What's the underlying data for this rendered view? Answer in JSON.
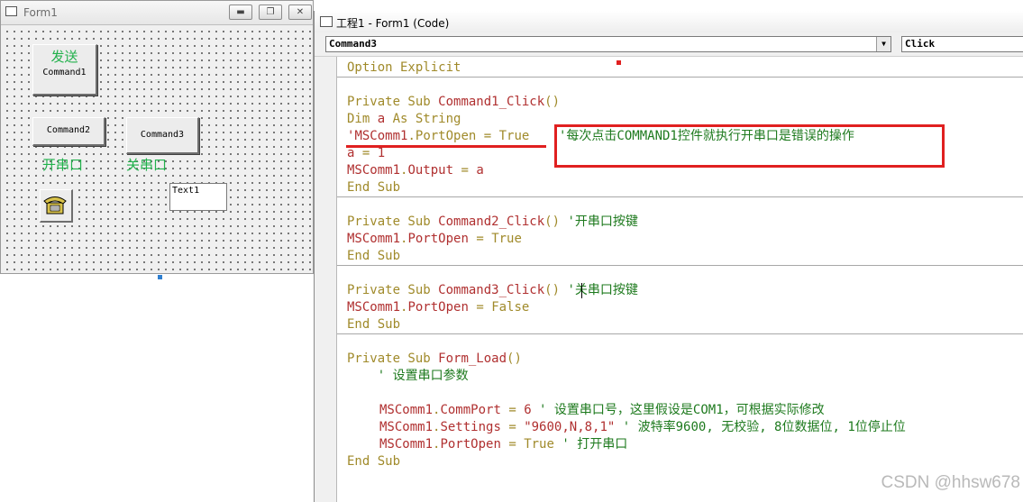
{
  "form_window": {
    "title": "Form1",
    "controls": {
      "send_caption": "发送",
      "command1": "Command1",
      "command2": "Command2",
      "command3": "Command3",
      "open_port_label": "开串口",
      "close_port_label": "关串口",
      "text1": "Text1"
    }
  },
  "code_window": {
    "title": "工程1 - Form1 (Code)",
    "object_combo": "Command3",
    "proc_combo": "Click",
    "lines": {
      "l1": "Option Explicit",
      "l2_kw": "Private Sub ",
      "l2_id": "Command1_Click",
      "l2_p": "()",
      "l3_kw": "Dim ",
      "l3_var": "a",
      "l3_rest": " As String",
      "l4_q": "'",
      "l4_obj": "MSComm1",
      "l4_dot": ".",
      "l4_prop": "PortOpen",
      "l4_eq": " = ",
      "l4_val": "True",
      "l4_comment": "'每次点击COMMAND1控件就执行开串口是错误的操作",
      "l5_var": "a",
      "l5_eq": " = ",
      "l5_num": "1",
      "l6_obj": "MSComm1",
      "l6_dot": ".",
      "l6_prop": "Output",
      "l6_eq": " = ",
      "l6_var": "a",
      "l7": "End Sub",
      "l8_kw": "Private Sub ",
      "l8_id": "Command2_Click",
      "l8_p": "()",
      "l8_comment": " '开串口按键",
      "l9_obj": "MSComm1",
      "l9_dot": ".",
      "l9_prop": "PortOpen",
      "l9_eq": " = ",
      "l9_val": "True",
      "l10": "End Sub",
      "l11_kw": "Private Sub ",
      "l11_id": "Command3_Click",
      "l11_p": "()",
      "l11_comment": " '关串口按键",
      "l12_obj": "MSComm1",
      "l12_dot": ".",
      "l12_prop": "PortOpen",
      "l12_eq": " = ",
      "l12_val": "False",
      "l13": "End Sub",
      "l14_kw": "Private Sub ",
      "l14_id": "Form_Load",
      "l14_p": "()",
      "l15": "    ' 设置串口参数",
      "l16_obj": "MSComm1",
      "l16_dot": ".",
      "l16_prop": "CommPort",
      "l16_eq": " = ",
      "l16_num": "6",
      "l16_comment": " ' 设置串口号，这里假设是COM1，可根据实际修改",
      "l17_obj": "MSComm1",
      "l17_dot": ".",
      "l17_prop": "Settings",
      "l17_eq": " = ",
      "l17_str": "\"9600,N,8,1\"",
      "l17_comment": " ' 波特率9600, 无校验, 8位数据位, 1位停止位",
      "l18_obj": "MSComm1",
      "l18_dot": ".",
      "l18_prop": "PortOpen",
      "l18_eq": " = ",
      "l18_val": "True",
      "l18_comment": " ' 打开串口",
      "l19": "End Sub"
    }
  },
  "watermark": "CSDN @hhsw678",
  "colors": {
    "keyword": "#a08a2a",
    "identifier": "#b03030",
    "comment": "#1e7a1e",
    "annotation": "#e02020",
    "label_green": "#22b14c"
  }
}
